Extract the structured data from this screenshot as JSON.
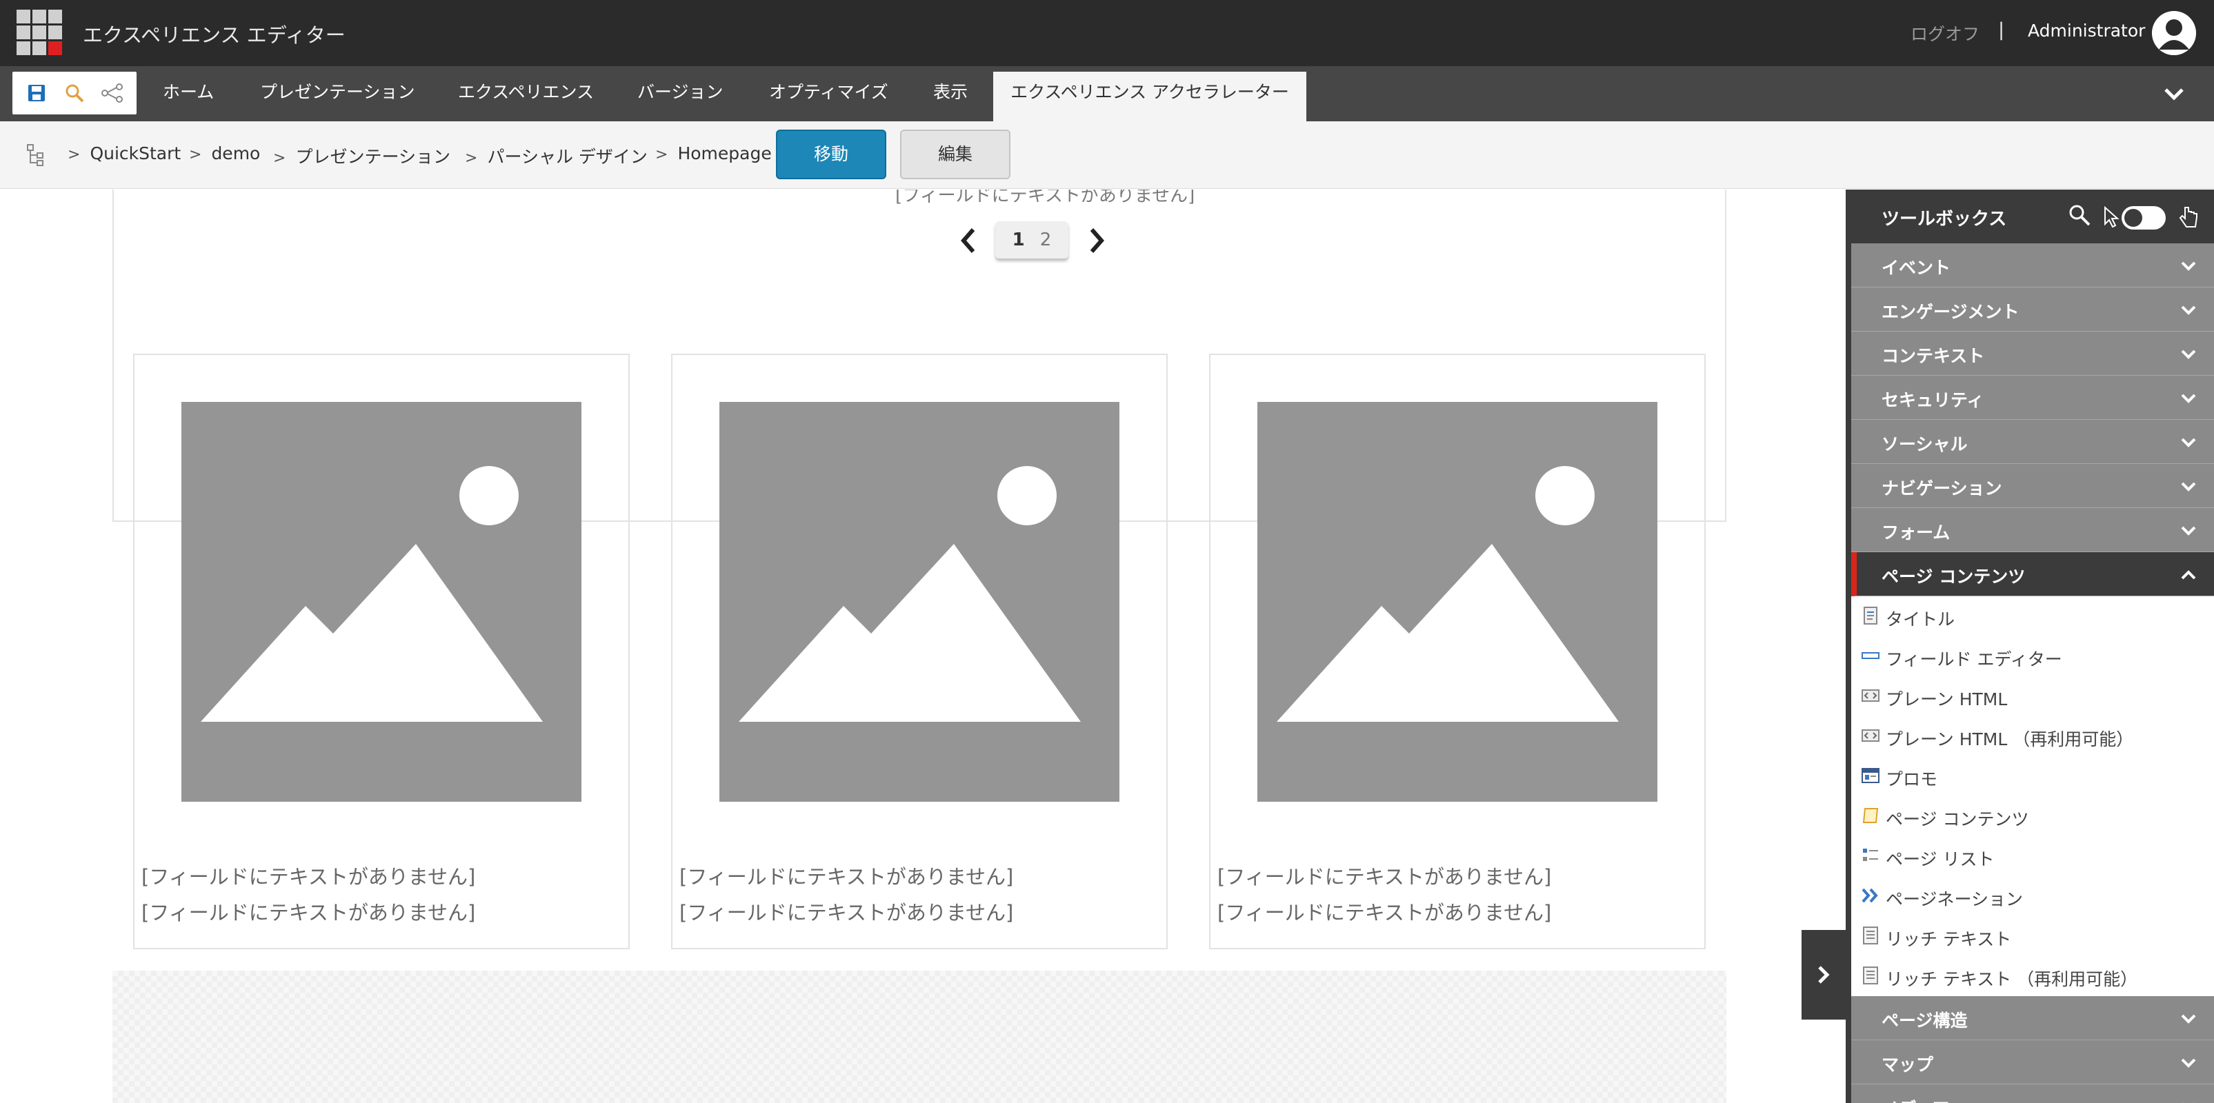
{
  "app": {
    "title": "エクスペリエンス エディター",
    "logoff": "ログオフ",
    "separator": "|",
    "user": "Administrator"
  },
  "ribbon": {
    "tabs": [
      {
        "label": "ホーム"
      },
      {
        "label": "プレゼンテーション"
      },
      {
        "label": "エクスペリエンス"
      },
      {
        "label": "バージョン"
      },
      {
        "label": "オプティマイズ"
      },
      {
        "label": "表示"
      },
      {
        "label": "エクスペリエンス アクセラレーター",
        "active": true
      }
    ]
  },
  "breadcrumb": {
    "items": [
      "QuickStart",
      "demo",
      "プレゼンテーション",
      "パーシャル デザイン",
      "Homepage"
    ],
    "move_button": "移動",
    "edit_button": "編集"
  },
  "canvas": {
    "empty_field": "[フィールドにテキストがありません]",
    "pager": {
      "current": "1",
      "other": "2"
    },
    "cards": [
      {
        "line1": "[フィールドにテキストがありません]",
        "line2": "[フィールドにテキストがありません]"
      },
      {
        "line1": "[フィールドにテキストがありません]",
        "line2": "[フィールドにテキストがありません]"
      },
      {
        "line1": "[フィールドにテキストがありません]",
        "line2": "[フィールドにテキストがありません]"
      }
    ]
  },
  "toolbox": {
    "title": "ツールボックス",
    "sections_before": [
      "イベント",
      "エンゲージメント",
      "コンテキスト",
      "セキュリティ",
      "ソーシャル",
      "ナビゲーション",
      "フォーム"
    ],
    "open_section": "ページ コンテンツ",
    "items": [
      {
        "label": "タイトル",
        "icon": "document-icon"
      },
      {
        "label": "フィールド エディター",
        "icon": "field-editor-icon"
      },
      {
        "label": "プレーン HTML",
        "icon": "html-icon"
      },
      {
        "label": "プレーン HTML （再利用可能）",
        "icon": "html-icon"
      },
      {
        "label": "プロモ",
        "icon": "promo-icon"
      },
      {
        "label": "ページ コンテンツ",
        "icon": "page-content-icon"
      },
      {
        "label": "ページ リスト",
        "icon": "page-list-icon"
      },
      {
        "label": "ページネーション",
        "icon": "pagination-icon"
      },
      {
        "label": "リッチ テキスト",
        "icon": "rich-text-icon"
      },
      {
        "label": "リッチ テキスト （再利用可能）",
        "icon": "rich-text-icon"
      }
    ],
    "sections_after": [
      "ページ構造",
      "マップ",
      "メディア"
    ]
  }
}
